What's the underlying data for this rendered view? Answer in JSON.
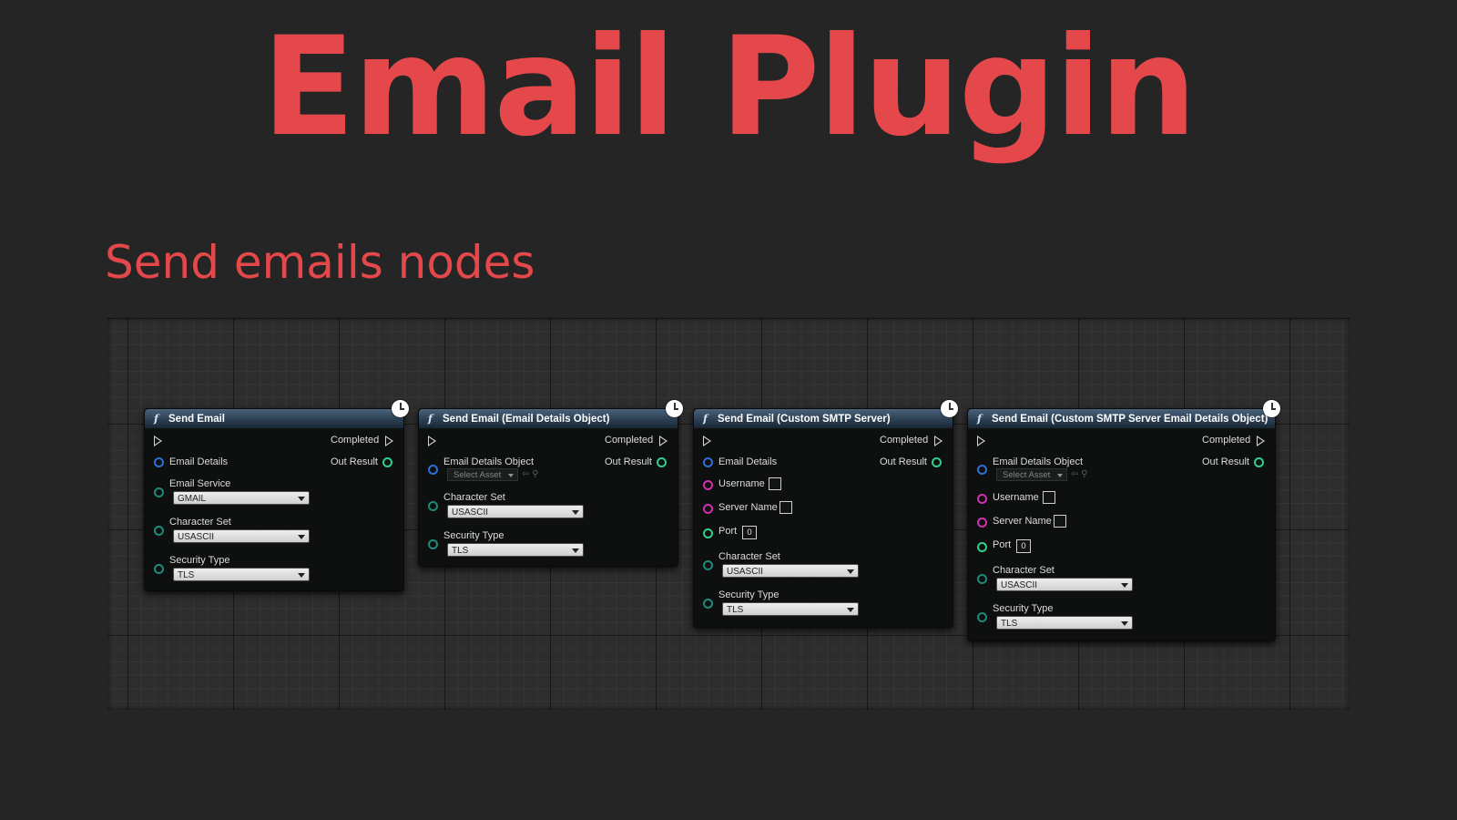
{
  "title": "Email Plugin",
  "subtitle": "Send emails nodes",
  "nodes": [
    {
      "header": "Send Email",
      "completed": "Completed",
      "out_result": "Out Result",
      "email_details": "Email Details",
      "email_service_label": "Email Service",
      "email_service_value": "GMAIL",
      "charset_label": "Character Set",
      "charset_value": "USASCII",
      "security_label": "Security Type",
      "security_value": "TLS"
    },
    {
      "header": "Send Email (Email Details Object)",
      "completed": "Completed",
      "out_result": "Out Result",
      "email_details": "Email Details Object",
      "asset_placeholder": "Select Asset",
      "charset_label": "Character Set",
      "charset_value": "USASCII",
      "security_label": "Security Type",
      "security_value": "TLS"
    },
    {
      "header": "Send Email (Custom SMTP Server)",
      "completed": "Completed",
      "out_result": "Out Result",
      "email_details": "Email Details",
      "username_label": "Username",
      "server_label": "Server Name",
      "port_label": "Port",
      "port_value": "0",
      "charset_label": "Character Set",
      "charset_value": "USASCII",
      "security_label": "Security Type",
      "security_value": "TLS"
    },
    {
      "header": "Send Email (Custom SMTP Server Email Details Object)",
      "completed": "Completed",
      "out_result": "Out Result",
      "email_details": "Email Details Object",
      "asset_placeholder": "Select Asset",
      "username_label": "Username",
      "server_label": "Server Name",
      "port_label": "Port",
      "port_value": "0",
      "charset_label": "Character Set",
      "charset_value": "USASCII",
      "security_label": "Security Type",
      "security_value": "TLS"
    }
  ],
  "icons": {
    "function": "function-icon",
    "latent": "clock-icon",
    "exec": "exec-pin-icon",
    "data": "data-pin-icon"
  },
  "colors": {
    "title": "#e4484b",
    "background": "#252525",
    "node_header": "#2b3f53",
    "struct_pin": "#2f6fd6",
    "enum_pin": "#1f8a7a",
    "string_pin": "#d12fb0",
    "int_pin": "#2fd18a"
  }
}
